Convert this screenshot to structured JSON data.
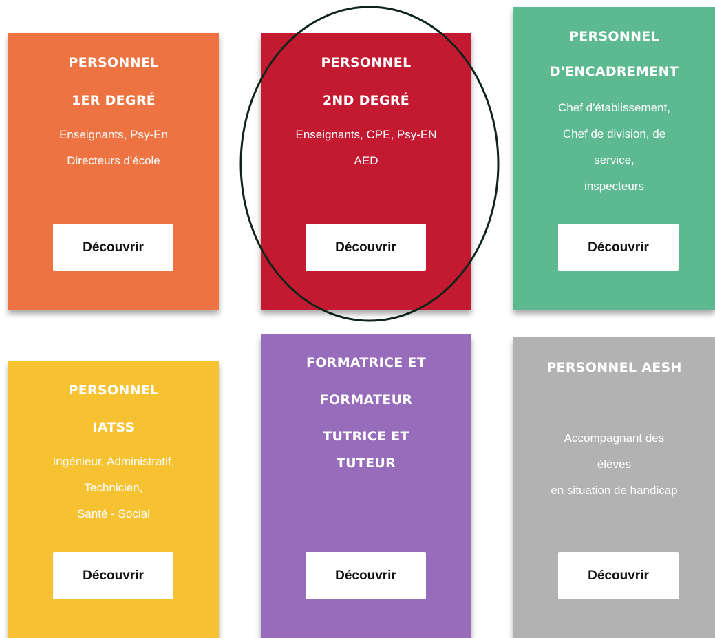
{
  "colors": {
    "card1": "#ED7442",
    "card2": "#C41A31",
    "card3": "#5CB990",
    "card4": "#F6C232",
    "card5": "#976CBA",
    "card6": "#B2B2B2",
    "highlight": "#0f2418"
  },
  "cards": [
    {
      "title_lines": [
        "PERSONNEL",
        "1ER DEGRÉ"
      ],
      "desc_lines": [
        "Enseignants, Psy-En",
        "Directeurs d'école"
      ],
      "button": "Découvrir"
    },
    {
      "title_lines": [
        "PERSONNEL",
        "2ND DEGRÉ"
      ],
      "desc_lines": [
        "Enseignants, CPE, Psy-EN",
        "AED"
      ],
      "button": "Découvrir"
    },
    {
      "title_lines": [
        "PERSONNEL",
        "D'ENCADREMENT"
      ],
      "desc_lines": [
        "Chef d'établissement,",
        "Chef de division, de",
        "service,",
        "inspecteurs"
      ],
      "button": "Découvrir"
    },
    {
      "title_lines": [
        "PERSONNEL",
        "IATSS"
      ],
      "desc_lines": [
        "Ingénieur, Administratif,",
        "Technicien,",
        "Santé - Social"
      ],
      "button": "Découvrir"
    },
    {
      "title_lines": [
        "FORMATRICE ET",
        "FORMATEUR",
        "TUTRICE ET",
        "TUTEUR"
      ],
      "desc_lines": [],
      "button": "Découvrir"
    },
    {
      "title_lines": [
        "PERSONNEL AESH"
      ],
      "desc_lines": [
        "Accompagnant des",
        "élèves",
        "en situation de handicap"
      ],
      "button": "Découvrir"
    }
  ]
}
